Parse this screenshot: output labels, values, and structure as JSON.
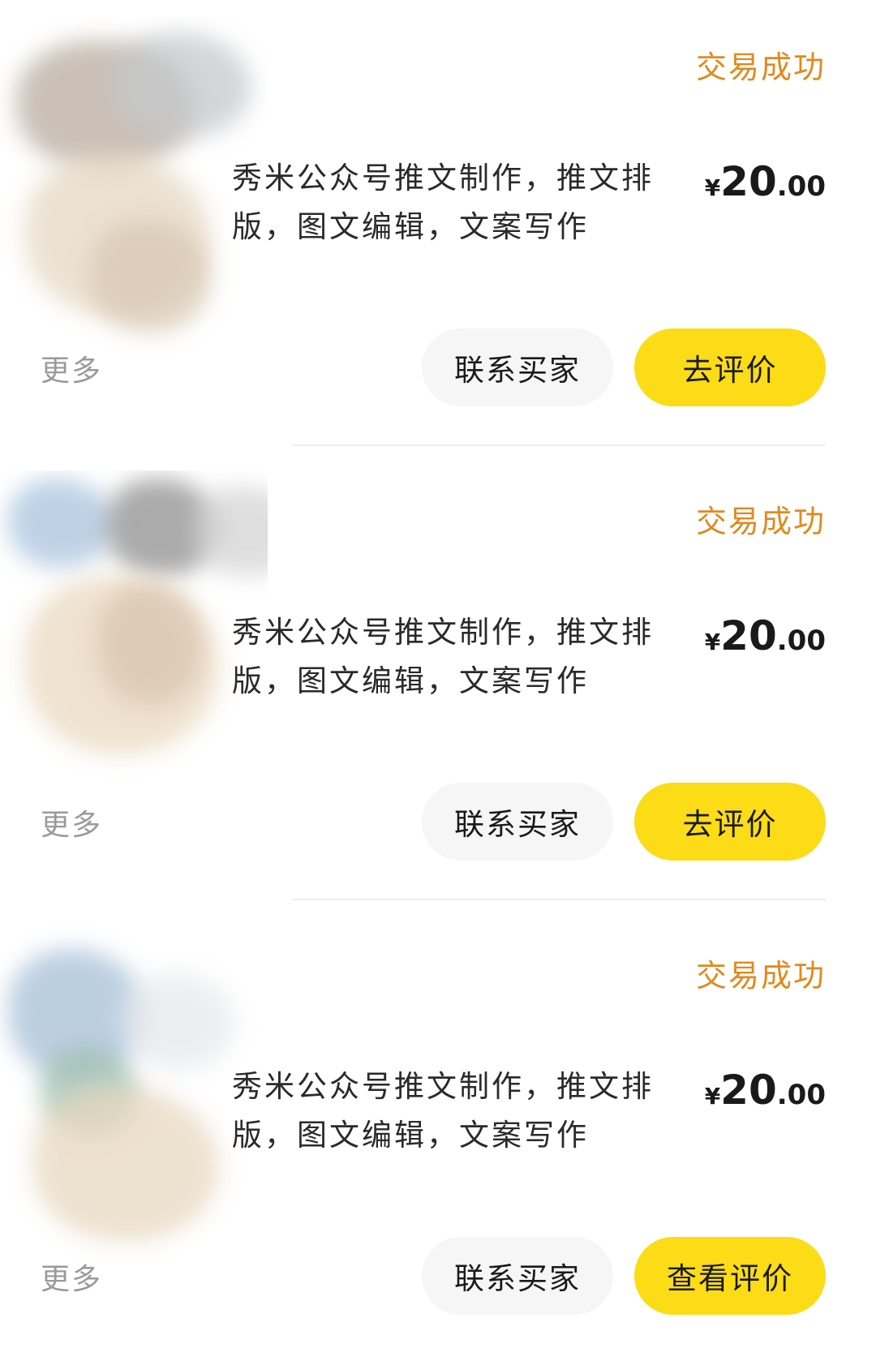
{
  "colors": {
    "status_text": "#e08a1e",
    "primary_button": "#fbdc17",
    "secondary_button": "#f6f6f6",
    "more_text": "#9a9a9a"
  },
  "orders": [
    {
      "status": "交易成功",
      "title": "秀米公众号推文制作，推文排版，图文编辑，文案写作",
      "price": {
        "currency": "¥",
        "integer": "20",
        "decimal": ".00"
      },
      "more_label": "更多",
      "contact_label": "联系买家",
      "action_label": "去评价"
    },
    {
      "status": "交易成功",
      "title": "秀米公众号推文制作，推文排版，图文编辑，文案写作",
      "price": {
        "currency": "¥",
        "integer": "20",
        "decimal": ".00"
      },
      "more_label": "更多",
      "contact_label": "联系买家",
      "action_label": "去评价"
    },
    {
      "status": "交易成功",
      "title": "秀米公众号推文制作，推文排版，图文编辑，文案写作",
      "price": {
        "currency": "¥",
        "integer": "20",
        "decimal": ".00"
      },
      "more_label": "更多",
      "contact_label": "联系买家",
      "action_label": "查看评价"
    }
  ]
}
